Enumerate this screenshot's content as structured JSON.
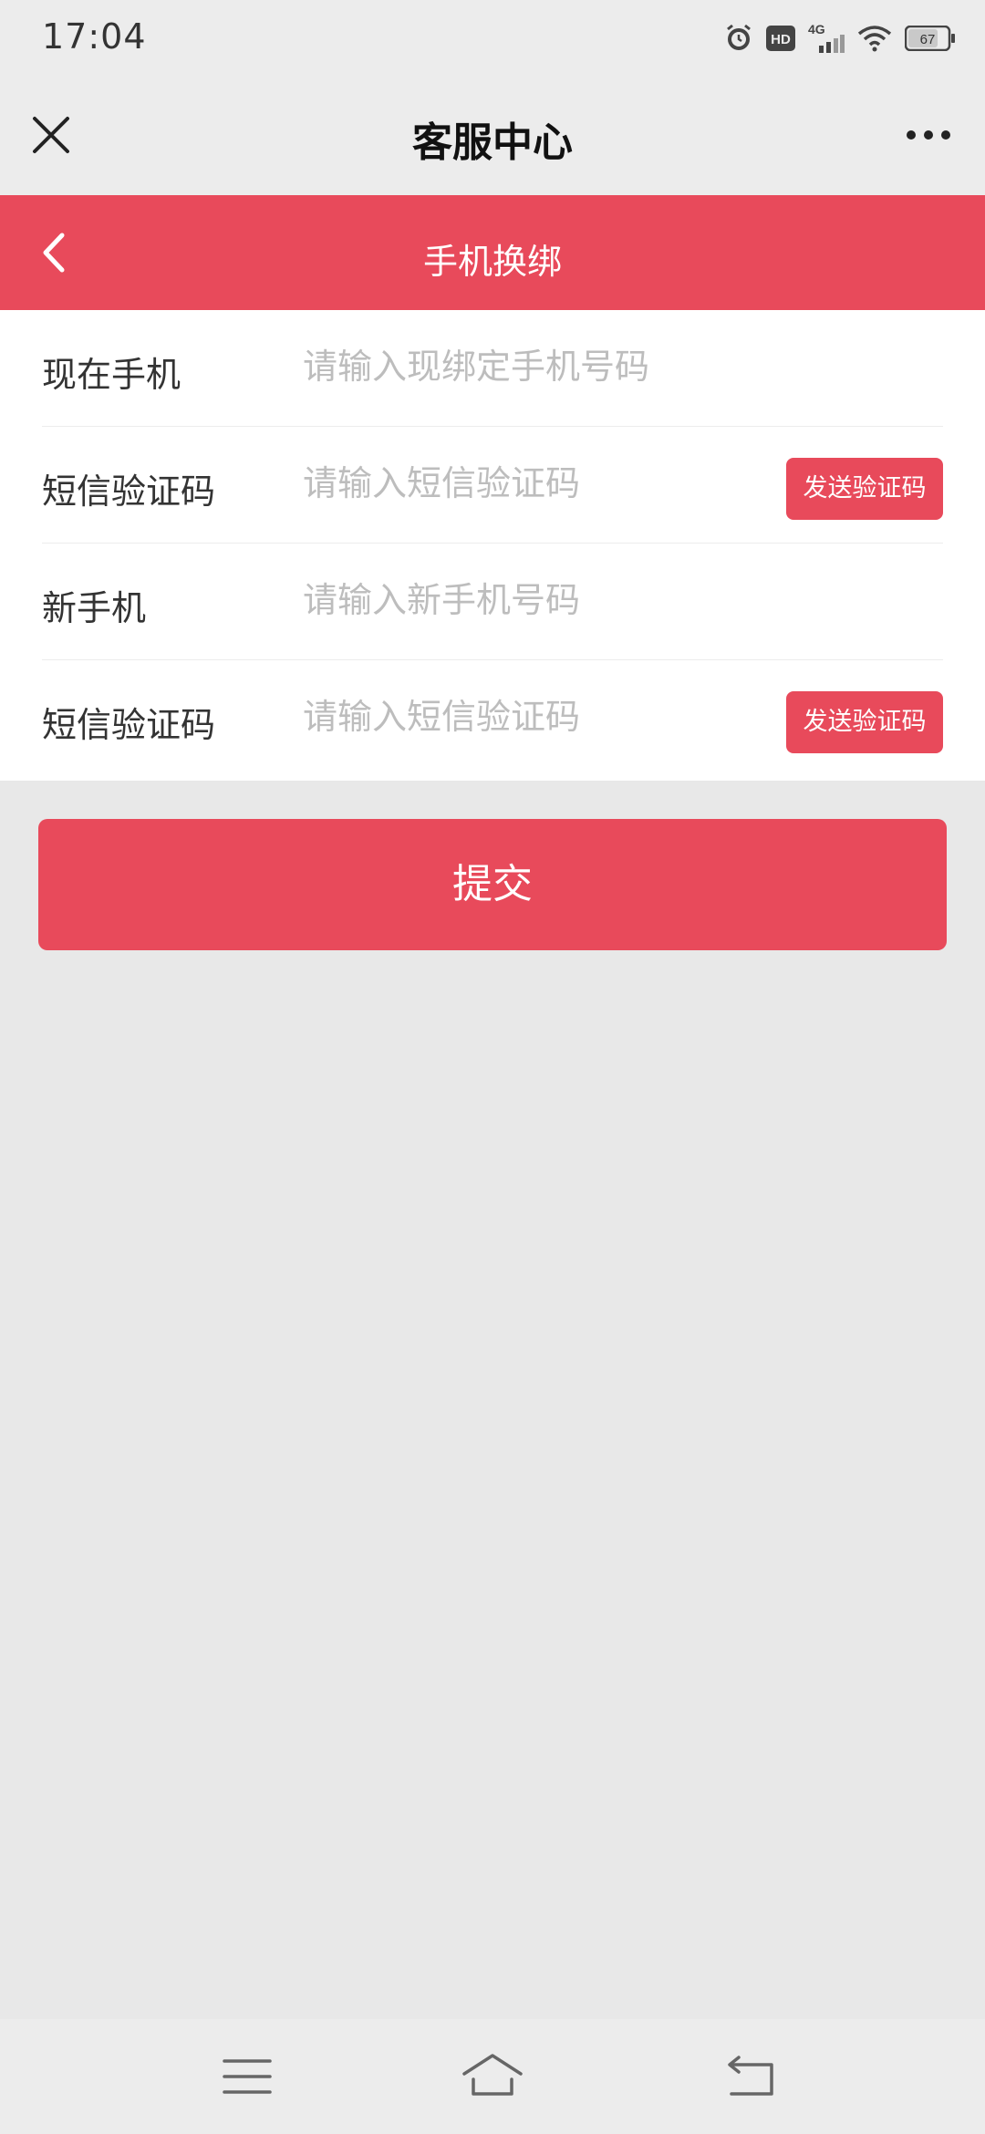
{
  "status_bar": {
    "time": "17:04",
    "network": "4G",
    "battery": "67",
    "icons": [
      "alarm-icon",
      "hd-icon",
      "signal-icon",
      "wifi-icon",
      "battery-icon"
    ]
  },
  "top_nav": {
    "title": "客服中心",
    "close_icon": "close-icon",
    "more_icon": "more-icon"
  },
  "header": {
    "title": "手机换绑",
    "back_icon": "chevron-left-icon",
    "accent_color": "#e84a5b"
  },
  "form": {
    "rows": [
      {
        "label": "现在手机",
        "placeholder": "请输入现绑定手机号码",
        "value": ""
      },
      {
        "label": "短信验证码",
        "placeholder": "请输入短信验证码",
        "value": "",
        "button": "发送验证码"
      },
      {
        "label": "新手机",
        "placeholder": "请输入新手机号码",
        "value": ""
      },
      {
        "label": "短信验证码",
        "placeholder": "请输入短信验证码",
        "value": "",
        "button": "发送验证码"
      }
    ]
  },
  "submit": {
    "label": "提交"
  },
  "system_nav": {
    "icons": [
      "menu-icon",
      "home-icon",
      "back-icon"
    ]
  }
}
